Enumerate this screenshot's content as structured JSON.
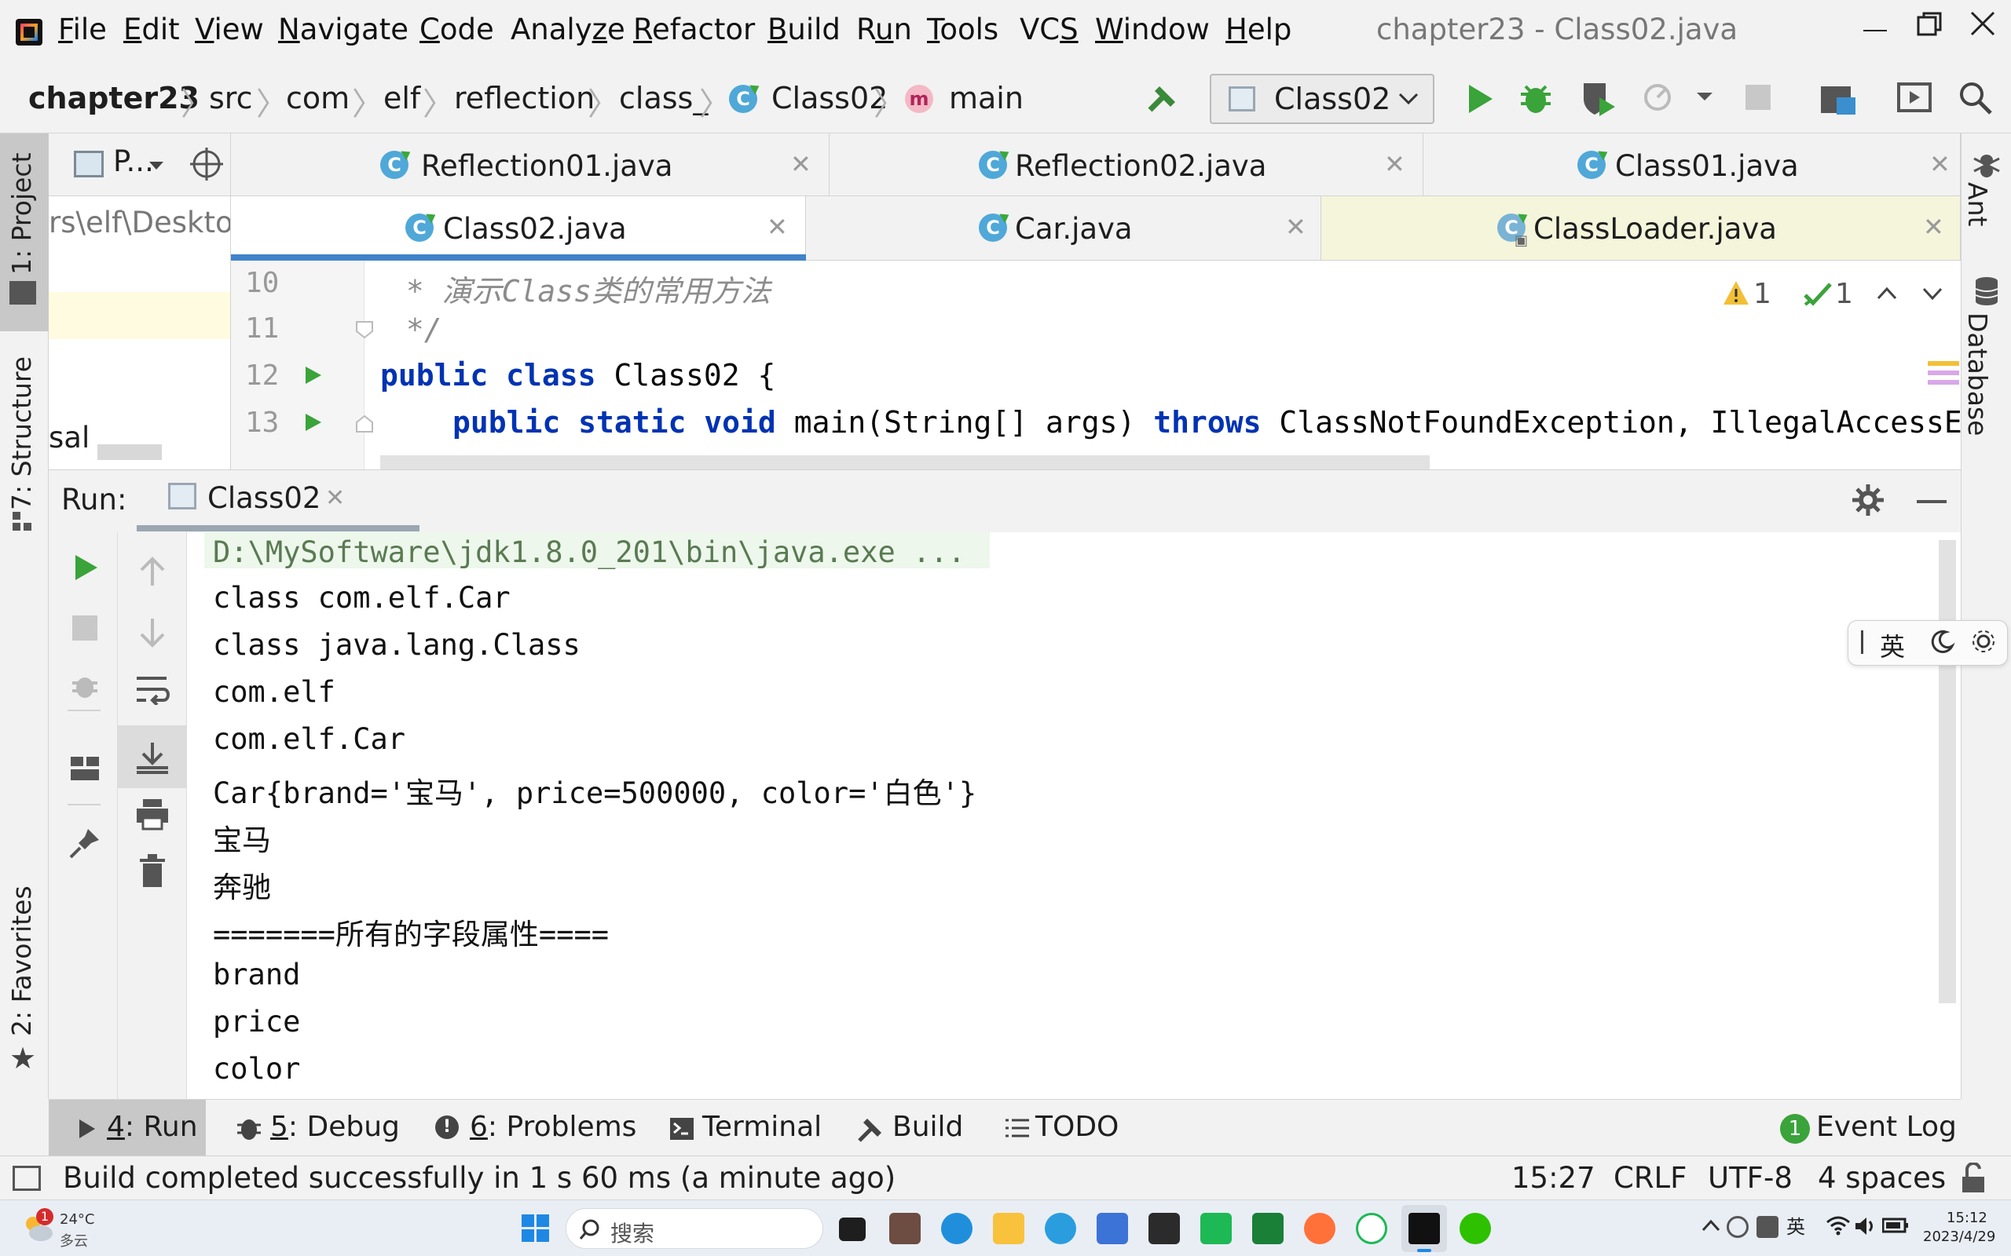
{
  "menubar": {
    "items": [
      {
        "u": "F",
        "rest": "ile"
      },
      {
        "u": "E",
        "rest": "dit"
      },
      {
        "u": "V",
        "rest": "iew"
      },
      {
        "u": "N",
        "rest": "avigate"
      },
      {
        "u": "C",
        "rest": "ode"
      },
      {
        "pre": "Analy",
        "u": "z",
        "rest": "e"
      },
      {
        "u": "R",
        "rest": "efactor"
      },
      {
        "u": "B",
        "rest": "uild"
      },
      {
        "pre": "R",
        "u": "u",
        "rest": "n"
      },
      {
        "u": "T",
        "rest": "ools"
      },
      {
        "pre": "VC",
        "u": "S",
        "rest": ""
      },
      {
        "u": "W",
        "rest": "indow"
      },
      {
        "u": "H",
        "rest": "elp"
      }
    ],
    "window_title": "chapter23 - Class02.java"
  },
  "navbar": {
    "breadcrumbs": [
      "chapter23",
      "src",
      "com",
      "elf",
      "reflection",
      "class_",
      "Class02",
      "main"
    ],
    "run_config": "Class02"
  },
  "left_strip": {
    "project": "1: Project",
    "structure": "7: Structure",
    "favorites": "2: Favorites"
  },
  "right_strip": {
    "ant": "Ant",
    "database": "Database"
  },
  "project_pane": {
    "title": "P...",
    "path_fragment": "rs\\elf\\Desktop",
    "row_fragment": "sal"
  },
  "tabs": {
    "row1": [
      "Reflection01.java",
      "Reflection02.java",
      "Class01.java"
    ],
    "row2": [
      "Class02.java",
      "Car.java",
      "ClassLoader.java"
    ]
  },
  "editor": {
    "lines": [
      {
        "n": "10",
        "comment": " * 演示Class类的常用方法"
      },
      {
        "n": "11",
        "comment": " */"
      },
      {
        "n": "12",
        "kw1": "public",
        "kw2": "class",
        "text": " Class02 {"
      },
      {
        "n": "13",
        "kw1": "public static void",
        "text": " main(String[] args) ",
        "kw3": "throws",
        "text2": " ClassNotFoundException, IllegalAccessE"
      }
    ],
    "inspections": {
      "warnings": "1",
      "ok": "1"
    }
  },
  "run": {
    "label": "Run:",
    "tab": "Class02",
    "output": [
      "D:\\MySoftware\\jdk1.8.0_201\\bin\\java.exe ...",
      "class com.elf.Car",
      "class java.lang.Class",
      "com.elf",
      "com.elf.Car",
      "Car{brand='宝马', price=500000, color='白色'}",
      "宝马",
      "奔驰",
      "=======所有的字段属性====",
      "brand",
      "price",
      "color"
    ]
  },
  "bottom_tabs": {
    "run": {
      "u": "4",
      "rest": ": Run"
    },
    "debug": {
      "u": "5",
      "rest": ": Debug"
    },
    "problems": {
      "u": "6",
      "rest": ": Problems"
    },
    "terminal": "Terminal",
    "build": "Build",
    "todo": "TODO",
    "event_log": "Event Log",
    "event_count": "1"
  },
  "statusbar": {
    "message": "Build completed successfully in 1 s 60 ms (a minute ago)",
    "position": "15:27",
    "line_sep": "CRLF",
    "encoding": "UTF-8",
    "indent": "4 spaces"
  },
  "taskbar": {
    "weather_temp": "24°C",
    "weather_desc": "多云",
    "weather_badge": "1",
    "search_placeholder": "搜索",
    "ime_lang": "英",
    "time": "15:12",
    "date": "2023/4/29"
  },
  "ime": {
    "lang": "英"
  }
}
